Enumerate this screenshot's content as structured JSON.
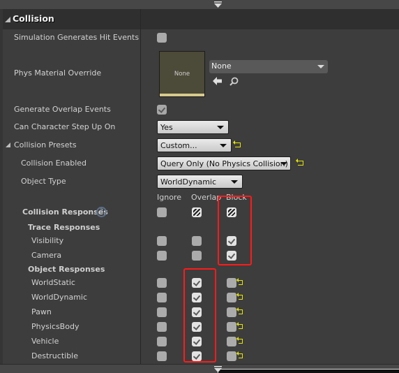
{
  "category": {
    "title": "Collision"
  },
  "properties": {
    "sim_hit_events": {
      "label": "Simulation Generates Hit Events",
      "checked": false
    },
    "phys_material": {
      "label": "Phys Material Override",
      "thumbnail_text": "None",
      "value": "None"
    },
    "overlap_events": {
      "label": "Generate Overlap Events",
      "checked": true
    },
    "step_up": {
      "label": "Can Character Step Up On",
      "value": "Yes"
    },
    "presets": {
      "label": "Collision Presets",
      "value": "Custom..."
    },
    "collision_enabled": {
      "label": "Collision Enabled",
      "value": "Query Only (No Physics Collision)"
    },
    "object_type": {
      "label": "Object Type",
      "value": "WorldDynamic"
    }
  },
  "responses": {
    "columns": [
      "Ignore",
      "Overlap",
      "Block"
    ],
    "header_label": "Collision Responses",
    "help_glyph": "?",
    "header_states": [
      "unchecked",
      "mixed",
      "mixed"
    ],
    "trace_label": "Trace Responses",
    "trace": [
      {
        "name": "Visibility",
        "state": "Block"
      },
      {
        "name": "Camera",
        "state": "Block"
      }
    ],
    "object_label": "Object Responses",
    "object": [
      {
        "name": "WorldStatic",
        "state": "Overlap"
      },
      {
        "name": "WorldDynamic",
        "state": "Overlap"
      },
      {
        "name": "Pawn",
        "state": "Overlap"
      },
      {
        "name": "PhysicsBody",
        "state": "Overlap"
      },
      {
        "name": "Vehicle",
        "state": "Overlap"
      },
      {
        "name": "Destructible",
        "state": "Overlap"
      }
    ]
  },
  "icons": {
    "use_selected": "arrow-left-icon",
    "browse": "search-icon",
    "reset": "reset-to-default-icon"
  },
  "colors": {
    "highlight": "#ff1a1a",
    "reset_arrow": "#e6e600",
    "panel_bg": "#3d3d3d"
  }
}
